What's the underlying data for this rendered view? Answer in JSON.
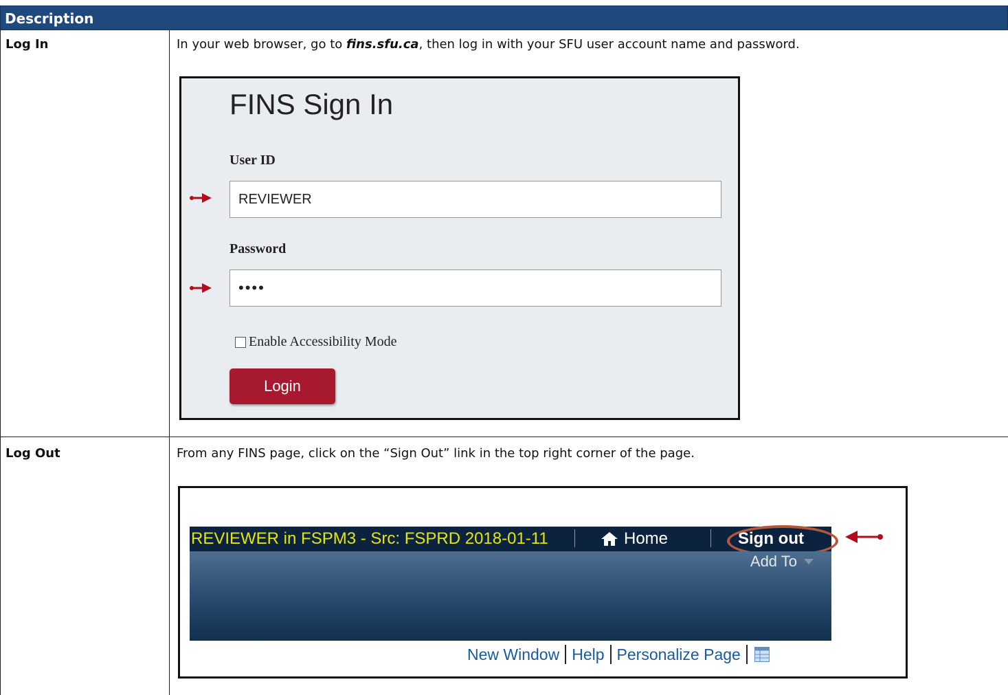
{
  "header": {
    "title": "Description"
  },
  "rows": [
    {
      "label": "Log In",
      "desc_prefix": "In your web browser, go to ",
      "desc_link": "fins.sfu.ca",
      "desc_suffix": ", then log in with your SFU user account name and password."
    },
    {
      "label": "Log Out",
      "desc": "From any FINS page, click on the “Sign Out” link in the top right corner of the page."
    }
  ],
  "login": {
    "title": "FINS Sign In",
    "userid_label": "User ID",
    "userid_value": "REVIEWER",
    "password_label": "Password",
    "password_value": "••••",
    "accessibility_label": "Enable Accessibility Mode",
    "login_button": "Login",
    "accent_color": "#a6192e",
    "arrow_icon": "red-arrow-icon"
  },
  "logout": {
    "user_info": "REVIEWER in FSPM3 - Src: FSPRD 2018-01-11",
    "home_label": "Home",
    "signout_label": "Sign out",
    "add_to_label": "Add To",
    "links": [
      "New Window",
      "Help",
      "Personalize Page"
    ],
    "highlight_color": "#b5583a"
  }
}
